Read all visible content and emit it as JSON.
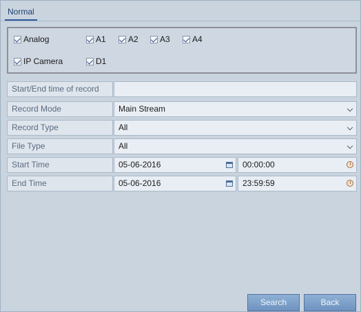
{
  "tab": "Normal",
  "cameras": {
    "analog": {
      "label": "Analog",
      "checked": true
    },
    "analog_channels": [
      {
        "label": "A1",
        "checked": true
      },
      {
        "label": "A2",
        "checked": true
      },
      {
        "label": "A3",
        "checked": true
      },
      {
        "label": "A4",
        "checked": true
      }
    ],
    "ip": {
      "label": "IP Camera",
      "checked": true
    },
    "ip_channels": [
      {
        "label": "D1",
        "checked": true
      }
    ]
  },
  "form": {
    "start_end_label": "Start/End time of record",
    "start_end_value": "",
    "record_mode": {
      "label": "Record Mode",
      "value": "Main Stream"
    },
    "record_type": {
      "label": "Record Type",
      "value": "All"
    },
    "file_type": {
      "label": "File Type",
      "value": "All"
    },
    "start_time": {
      "label": "Start Time",
      "date": "05-06-2016",
      "time": "00:00:00"
    },
    "end_time": {
      "label": "End Time",
      "date": "05-06-2016",
      "time": "23:59:59"
    }
  },
  "buttons": {
    "search": "Search",
    "back": "Back"
  }
}
